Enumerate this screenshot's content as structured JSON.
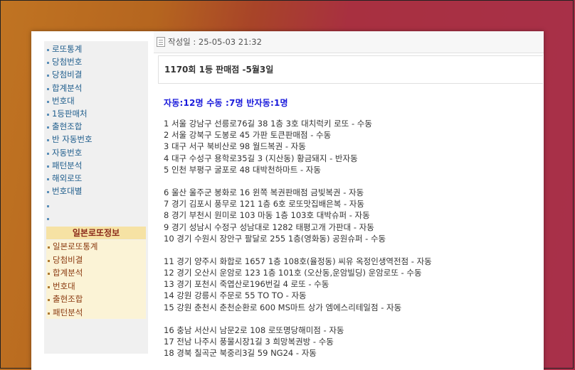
{
  "sidebar": {
    "menu": [
      "로또통계",
      "당첨번호",
      "당첨비결",
      "합계분석",
      "번호대",
      "1등판매처",
      "출현조합",
      "반 자동번호",
      "자동번호",
      "패턴분석",
      "해외로또",
      "번호대별"
    ],
    "jp_title": "일본로또정보",
    "jp_menu": [
      "일본로또통계",
      "당첨비결",
      "합계분석",
      "번호대",
      "출현조합",
      "패턴분석"
    ]
  },
  "post": {
    "date": "작성일 : 25-05-03 21:32",
    "title": "1170회 1등 판매점 -5월3일",
    "summary": "자동:12명 수동 :7명 반자동:1명",
    "groups": [
      [
        "1 서울 강남구 선릉로76길 38 1층 3호 대치럭키 로또 - 수동",
        "2 서울 강북구 도봉로 45 가판 토큰판매점 - 수동",
        "3 대구 서구 북비산로 98 월드복권 - 자동",
        "4 대구 수성구 용학로35길 3 (지산동) 황금돼지 - 반자동",
        "5 인천 부평구 굴포로 48 대박천하마트 - 자동"
      ],
      [
        "6 울산 울주군 봉화로 16 윈쪽 복권판매점 금빛복권 - 자동",
        "7 경기 김포시 풍무로 121 1층 6호 로또맛집배은복 - 자동",
        "8 경기 부천시 원미로 103 마동 1층 103호 대박슈퍼 - 자동",
        "9 경기 성남시 수정구 성남대로 1282 태평고개 가판대 - 자동",
        "10 경기 수원시 장안구 팔달로 255 1층(영화동) 공원슈퍼 - 수동"
      ],
      [
        "11 경기 양주시 화합로 1657 1층 108호(율정동) 씨유 옥정인생역전점 - 자동",
        "12 경기 오산시 운암로 123 1층 101호 (오산동,운암빌딩) 운암로또 - 수동",
        "13 경기 포천시 죽엽산로196번길 4 로또 - 수동",
        "14 강원 강릉시 주문로 55 TO TO - 자동",
        "15 강원 춘천시 춘천순환로 600 MS마트 상가 엠에스리테일점 - 자동"
      ],
      [
        "16 충남 서산시 남문2로 108 로또명당해미점 - 자동",
        "17 전남 나주시 풍물시장1길 3 희망복권방 - 수동",
        "18 경북 칠곡군 북중리3길 59 NG24 - 자동"
      ]
    ]
  },
  "colors": {
    "summary": "#1a1adb",
    "menu_link": "#1f5d8c",
    "jp_header_bg": "#f6e2a4",
    "jp_header_text": "#8b2a1a"
  },
  "icons": [
    "document-icon"
  ]
}
